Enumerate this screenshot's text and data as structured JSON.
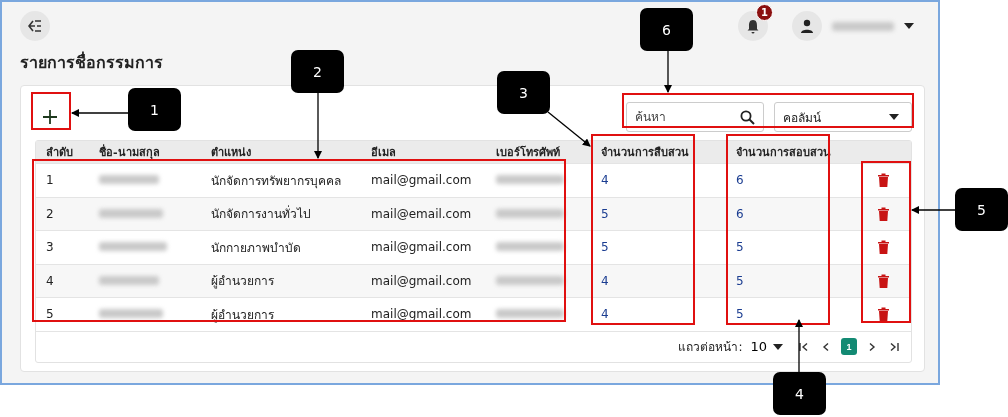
{
  "header": {
    "notification_count": "1"
  },
  "title": "รายการชื่อกรรมการ",
  "search": {
    "placeholder": "ค้นหา"
  },
  "column_select": {
    "value": "คอลัมน์"
  },
  "table": {
    "columns": [
      "ลำดับ",
      "ชื่อ-นามสกุล",
      "ตำแหน่ง",
      "อีเมล",
      "เบอร์โทรศัพท์",
      "จำนวนการสืบสวน",
      "จำนวนการสอบสวน"
    ],
    "rows": [
      {
        "index": "1",
        "position": "นักจัดการทรัพยากรบุคคล",
        "email": "mail@gmail.com",
        "investigations": "4",
        "inquiries": "6"
      },
      {
        "index": "2",
        "position": "นักจัดการงานทั่วไป",
        "email": "mail@email.com",
        "investigations": "5",
        "inquiries": "6"
      },
      {
        "index": "3",
        "position": "นักกายภาพบำบัด",
        "email": "mail@gmail.com",
        "investigations": "5",
        "inquiries": "5"
      },
      {
        "index": "4",
        "position": "ผู้อำนวยการ",
        "email": "mail@gmail.com",
        "investigations": "4",
        "inquiries": "5"
      },
      {
        "index": "5",
        "position": "ผู้อำนวยการ",
        "email": "mail@gmail.com",
        "investigations": "4",
        "inquiries": "5"
      }
    ]
  },
  "pagination": {
    "rows_per_page_label": "แถวต่อหน้า:",
    "rows_per_page": "10",
    "pages": [
      {
        "label": "1",
        "selected": true
      }
    ]
  },
  "callouts": [
    {
      "label": "1"
    },
    {
      "label": "2"
    },
    {
      "label": "3"
    },
    {
      "label": "4"
    },
    {
      "label": "5"
    },
    {
      "label": "6"
    }
  ]
}
